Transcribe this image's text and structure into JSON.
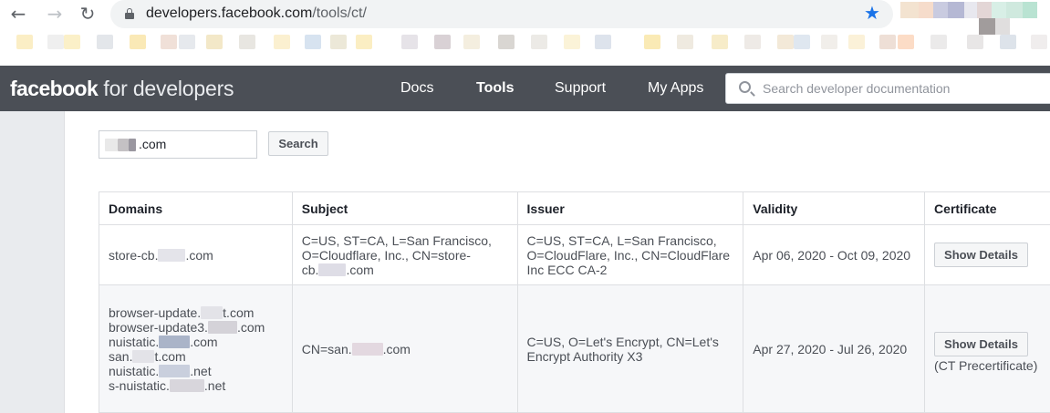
{
  "browser": {
    "url_domain": "developers.facebook.com",
    "url_path": "/tools/ct/",
    "back_glyph": "←",
    "forward_glyph": "→",
    "reload_glyph": "↻",
    "star_glyph": "★"
  },
  "header": {
    "logo_bold": "facebook",
    "logo_light": "for developers",
    "nav": [
      {
        "label": "Docs"
      },
      {
        "label": "Tools"
      },
      {
        "label": "Support"
      },
      {
        "label": "My Apps"
      }
    ],
    "search_placeholder": "Search developer documentation"
  },
  "query": {
    "domain_suffix": ".com",
    "search_label": "Search"
  },
  "table": {
    "columns": [
      "Domains",
      "Subject",
      "Issuer",
      "Validity",
      "Certificate"
    ],
    "rows": [
      {
        "domain_prefix": "store-cb.",
        "domain_suffix": ".com",
        "subject_line1": "C=US, ST=CA, L=San Francisco,",
        "subject_line2": "O=Cloudflare, Inc., CN=store-",
        "subject_line3_prefix": "cb.",
        "subject_line3_suffix": ".com",
        "issuer": "C=US, ST=CA, L=San Francisco, O=CloudFlare, Inc., CN=CloudFlare Inc ECC CA-2",
        "validity": "Apr 06, 2020 - Oct 09, 2020",
        "button": "Show Details",
        "note": ""
      },
      {
        "domains": [
          {
            "prefix": "browser-update.",
            "suffix": "t.com"
          },
          {
            "prefix": "browser-update3.",
            "suffix": ".com"
          },
          {
            "prefix": "nuistatic.",
            "suffix": ".com"
          },
          {
            "prefix": "san.",
            "suffix": "t.com"
          },
          {
            "prefix": "nuistatic.",
            "suffix": ".net"
          },
          {
            "prefix": "s-nuistatic.",
            "suffix": ".net"
          }
        ],
        "subject_prefix": "CN=san.",
        "subject_suffix": ".com",
        "issuer": "C=US, O=Let's Encrypt, CN=Let's Encrypt Authority X3",
        "validity": "Apr 27, 2020 - Jul 26, 2020",
        "button": "Show Details",
        "note": "(CT Precertificate)"
      }
    ]
  },
  "colors": {
    "fb_bar": "#4b4f56",
    "left_rail": "#e9ebee",
    "star": "#1a73e8"
  }
}
